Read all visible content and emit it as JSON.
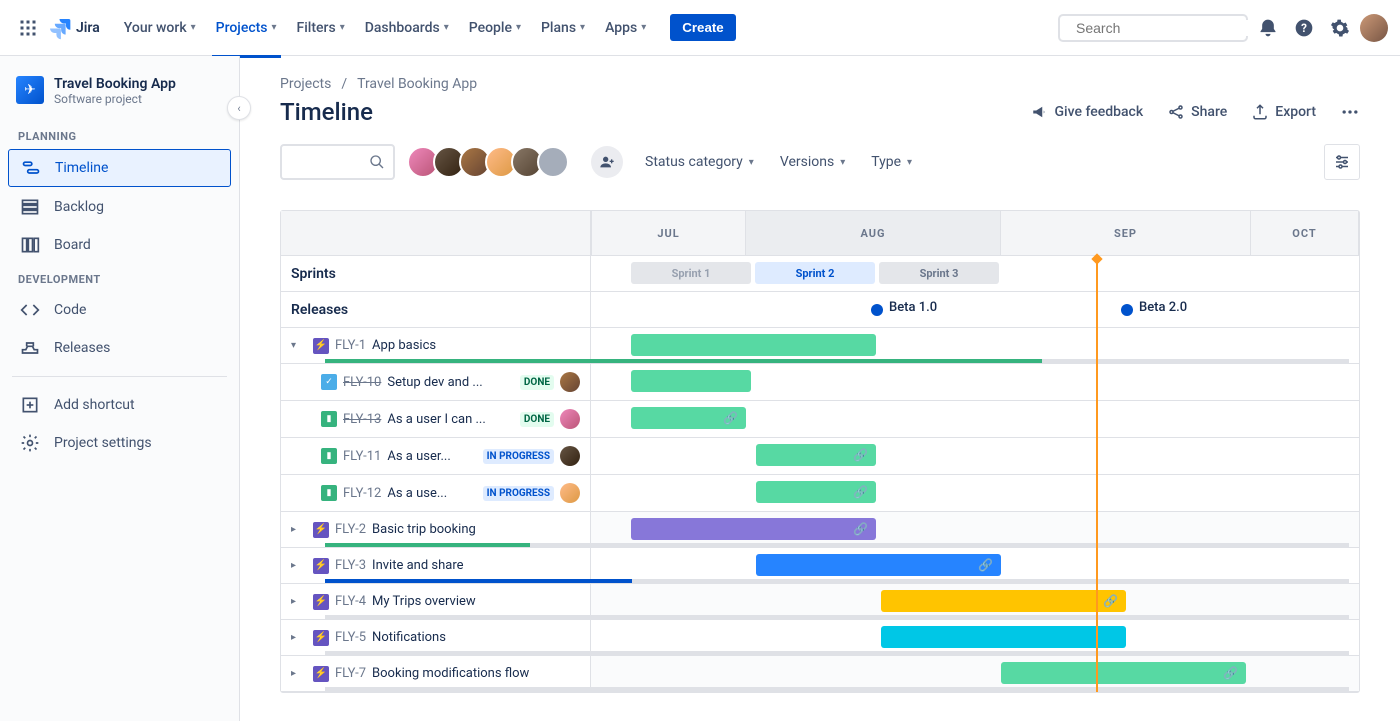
{
  "brand": "Jira",
  "nav": {
    "your_work": "Your work",
    "projects": "Projects",
    "filters": "Filters",
    "dashboards": "Dashboards",
    "people": "People",
    "plans": "Plans",
    "apps": "Apps",
    "create": "Create"
  },
  "search_placeholder": "Search",
  "project": {
    "name": "Travel Booking App",
    "subtitle": "Software project"
  },
  "sidebar": {
    "planning_label": "PLANNING",
    "development_label": "DEVELOPMENT",
    "timeline": "Timeline",
    "backlog": "Backlog",
    "board": "Board",
    "code": "Code",
    "releases": "Releases",
    "add_shortcut": "Add shortcut",
    "project_settings": "Project settings"
  },
  "breadcrumb": {
    "projects": "Projects",
    "current": "Travel Booking App"
  },
  "page_title": "Timeline",
  "actions": {
    "feedback": "Give feedback",
    "share": "Share",
    "export": "Export"
  },
  "filters": {
    "status": "Status category",
    "versions": "Versions",
    "type": "Type"
  },
  "months": [
    "JUL",
    "AUG",
    "SEP",
    "OCT"
  ],
  "sprints_label": "Sprints",
  "releases_label": "Releases",
  "sprints": [
    {
      "name": "Sprint 1",
      "state": "done"
    },
    {
      "name": "Sprint 2",
      "state": "active"
    },
    {
      "name": "Sprint 3",
      "state": "future"
    }
  ],
  "releases": [
    {
      "name": "Beta 1.0"
    },
    {
      "name": "Beta 2.0"
    }
  ],
  "epics": [
    {
      "key": "FLY-1",
      "title": "App basics",
      "expanded": true,
      "bar_color": "#57D9A3",
      "progress": 70,
      "progress_color": "#36B37E",
      "children": [
        {
          "icon": "task",
          "key": "FLY-10",
          "strike": true,
          "title": "Setup dev and ...",
          "status": "DONE",
          "status_cls": "done",
          "av": "av3"
        },
        {
          "icon": "story",
          "key": "FLY-13",
          "strike": true,
          "title": "As a user I can ...",
          "status": "DONE",
          "status_cls": "done",
          "av": "av1"
        },
        {
          "icon": "story",
          "key": "FLY-11",
          "strike": false,
          "title": "As a user...",
          "status": "IN PROGRESS",
          "status_cls": "progress",
          "av": "av2"
        },
        {
          "icon": "story",
          "key": "FLY-12",
          "strike": false,
          "title": "As a use...",
          "status": "IN PROGRESS",
          "status_cls": "progress",
          "av": "av4"
        }
      ]
    },
    {
      "key": "FLY-2",
      "title": "Basic trip booking",
      "expanded": false,
      "bar_color": "#8777D9",
      "progress": 20,
      "progress_color": "#36B37E"
    },
    {
      "key": "FLY-3",
      "title": "Invite and share",
      "expanded": false,
      "bar_color": "#2684FF",
      "progress": 30,
      "progress_color": "#0052CC"
    },
    {
      "key": "FLY-4",
      "title": "My Trips overview",
      "expanded": false,
      "bar_color": "#FFC400",
      "progress": 0,
      "progress_color": "#DFE1E6"
    },
    {
      "key": "FLY-5",
      "title": "Notifications",
      "expanded": false,
      "bar_color": "#00C7E6",
      "progress": 0,
      "progress_color": "#DFE1E6"
    },
    {
      "key": "FLY-7",
      "title": "Booking modifications flow",
      "expanded": false,
      "bar_color": "#57D9A3",
      "progress": 0,
      "progress_color": "#DFE1E6"
    }
  ]
}
